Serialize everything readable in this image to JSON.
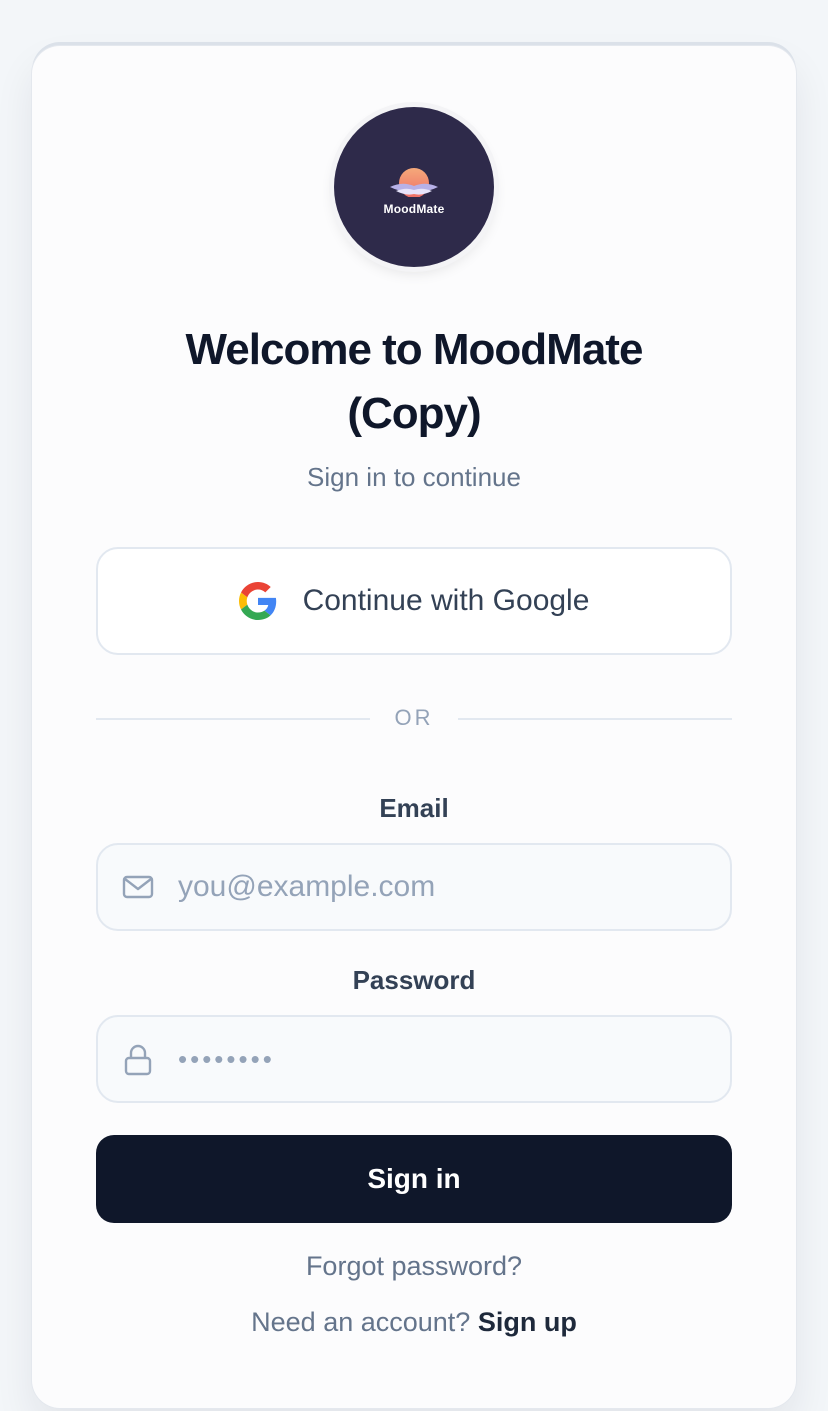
{
  "brand": {
    "logo_text": "MoodMate"
  },
  "header": {
    "title_line1": "Welcome to MoodMate",
    "title_line2": "(Copy)",
    "subtitle": "Sign in to continue"
  },
  "oauth": {
    "google_label": "Continue with Google",
    "google_icon": "google-g-icon"
  },
  "divider": {
    "text": "OR"
  },
  "form": {
    "email_label": "Email",
    "email_placeholder": "you@example.com",
    "email_value": "",
    "email_icon": "mail-icon",
    "password_label": "Password",
    "password_value": "password",
    "password_icon": "lock-icon",
    "submit_label": "Sign in"
  },
  "footer": {
    "forgot_label": "Forgot password?",
    "signup_prompt": "Need an account?",
    "signup_link": "Sign up"
  },
  "colors": {
    "primary": "#0f172a",
    "logo_bg": "#2e2a4a",
    "muted_text": "#64748b",
    "border": "#e2e8f0"
  }
}
